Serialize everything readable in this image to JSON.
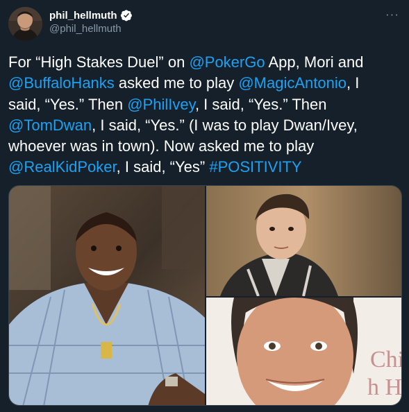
{
  "author": {
    "display_name": "phil_hellmuth",
    "handle": "@phil_hellmuth",
    "verified": true
  },
  "icons": {
    "verified": "verified-badge-icon",
    "more": "more-options-icon"
  },
  "tweet": {
    "lines": [
      [
        {
          "text": "For “High Stakes Duel” on "
        },
        {
          "text": "@PokerGo",
          "mention": true
        },
        {
          "text": " App, Mori and"
        }
      ],
      [
        {
          "text": "@BuffaloHanks",
          "mention": true
        },
        {
          "text": " asked me to play "
        },
        {
          "text": "@MagicAntonio",
          "mention": true
        },
        {
          "text": ", I"
        }
      ],
      [
        {
          "text": "said, “Yes.” Then "
        },
        {
          "text": "@PhilIvey",
          "mention": true
        },
        {
          "text": ", I said, “Yes.” Then"
        }
      ],
      [
        {
          "text": "@TomDwan",
          "mention": true
        },
        {
          "text": ", I said, “Yes.” (I was to play Dwan/Ivey,"
        }
      ],
      [
        {
          "text": "whoever was in town). Now asked me to play"
        }
      ],
      [
        {
          "text": "@RealKidPoker",
          "mention": true
        },
        {
          "text": ", I said, “Yes” "
        },
        {
          "text": "#POSITIVITY",
          "mention": true
        }
      ]
    ]
  },
  "media": {
    "photos": [
      "photo-phil-ivey",
      "photo-tom-dwan",
      "photo-daniel-negreanu"
    ],
    "background_text": "Chi h H"
  },
  "colors": {
    "background": "#15202b",
    "text": "#ffffff",
    "secondary": "#8899a6",
    "link": "#1da1f2",
    "border": "#38444d"
  }
}
